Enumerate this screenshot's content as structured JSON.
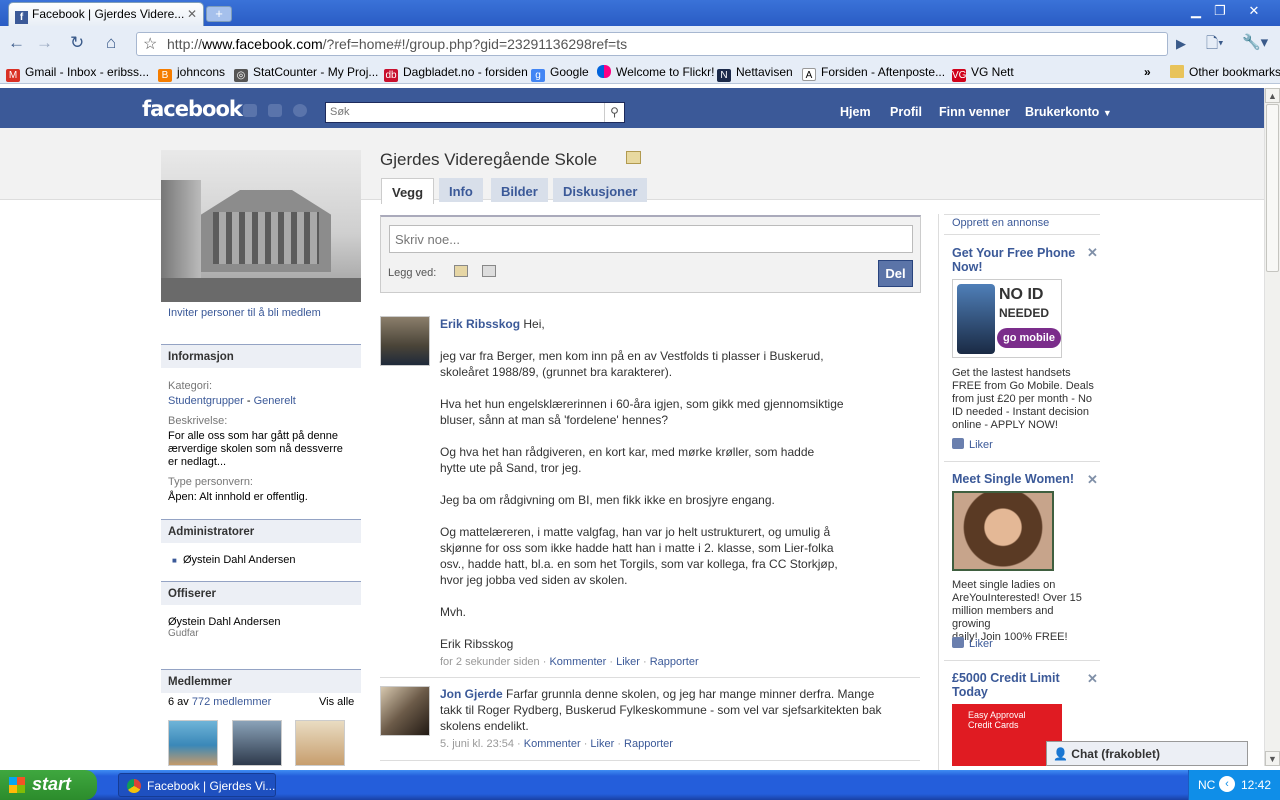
{
  "browser": {
    "tab_title": "Facebook | Gjerdes Videre...",
    "url_prefix": "http://",
    "url_domain": "www.facebook.com",
    "url_rest": "/?ref=home#!/group.php?gid=23291136298ref=ts",
    "bookmarks": [
      "Gmail - Inbox - eribss...",
      "johncons",
      "StatCounter - My Proj...",
      "Dagbladet.no - forsiden",
      "Google",
      "Welcome to Flickr!",
      "Nettavisen",
      "Forsiden - Aftenposte...",
      "VG Nett"
    ],
    "other_bookmarks": "Other bookmarks"
  },
  "fb": {
    "logo": "facebook",
    "search_placeholder": "Søk",
    "nav": [
      "Hjem",
      "Profil",
      "Finn venner",
      "Brukerkonto"
    ]
  },
  "group": {
    "title": "Gjerdes Videregående Skole",
    "tabs": [
      "Vegg",
      "Info",
      "Bilder",
      "Diskusjoner"
    ],
    "invite": "Inviter personer til å bli medlem",
    "info_head": "Informasjon",
    "category_label": "Kategori:",
    "category_a": "Studentgrupper",
    "category_dash": " - ",
    "category_b": "Generelt",
    "desc_label": "Beskrivelse:",
    "desc_1": "For alle oss som har gått på denne",
    "desc_2": "ærverdige skolen som nå dessverre",
    "desc_3": "er nedlagt...",
    "privacy_label": "Type personvern:",
    "privacy": "Åpen: Alt innhold er offentlig.",
    "admins_head": "Administratorer",
    "admin": "Øystein Dahl Andersen",
    "officers_head": "Offiserer",
    "officer": "Øystein Dahl Andersen",
    "officer_role": "Gudfar",
    "members_head": "Medlemmer",
    "members_of": "6 av ",
    "members_count": "772 medlemmer",
    "see_all": "Vis alle"
  },
  "composer": {
    "placeholder": "Skriv noe...",
    "attach": "Legg ved:",
    "share": "Del"
  },
  "posts": [
    {
      "author": "Erik Ribsskog",
      "lines": [
        "Hei,",
        "jeg var fra Berger, men kom inn på en av Vestfolds ti plasser i Buskerud,",
        "skoleåret 1988/89, (grunnet bra karakterer).",
        "Hva het hun engelsklærerinnen i 60-åra igjen, som gikk med gjennomsiktige",
        "bluser, sånn at man så 'fordelene' hennes?",
        "Og hva het han rådgiveren, en kort kar, med mørke krøller, som hadde",
        "hytte ute på Sand, tror jeg.",
        "Jeg ba om rådgivning om BI, men fikk ikke en brosjyre engang.",
        "Og mattelæreren, i matte valgfag, han var jo helt ustrukturert, og umulig å",
        "skjønne for oss som ikke hadde hatt han i matte i 2. klasse, som Lier-folka",
        "osv., hadde hatt, bl.a. en som het Torgils, som var kollega, fra CC Storkjøp,",
        "hvor jeg jobba ved siden av skolen.",
        "Mvh.",
        "Erik Ribsskog"
      ],
      "time": "for 2 sekunder siden",
      "actions": [
        "Kommenter",
        "Liker",
        "Rapporter"
      ]
    },
    {
      "author": "Jon Gjerde",
      "lines": [
        "Farfar grunnla denne skolen, og jeg har mange minner derfra. Mange",
        "takk til Roger Rydberg, Buskerud Fylkeskommune - som vel var sjefsarkitekten bak",
        "skolens endelikt."
      ],
      "time": "5. juni kl. 23:54",
      "actions": [
        "Kommenter",
        "Liker",
        "Rapporter"
      ]
    }
  ],
  "ads": {
    "create": "Opprett en annonse",
    "items": [
      {
        "title_1": "Get Your Free Phone",
        "title_2": "Now!",
        "img_1": "NO ID",
        "img_2": "NEEDED",
        "img_3": "go mobile",
        "text": [
          "Get the lastest handsets",
          "FREE from Go Mobile. Deals",
          "from just £20 per month - No",
          "ID needed - Instant decision",
          "online - APPLY NOW!"
        ],
        "like": "Liker"
      },
      {
        "title_1": "Meet Single Women!",
        "text": [
          "Meet single ladies on",
          "AreYouInterested! Over 15",
          "million members and growing",
          "daily! Join 100% FREE!"
        ],
        "like": "Liker"
      },
      {
        "title_1": "£5000 Credit Limit",
        "title_2": "Today",
        "img_1": "Easy Approval",
        "img_2": "Credit Cards"
      }
    ]
  },
  "chat": "Chat (frakoblet)",
  "taskbar": {
    "start": "start",
    "task": "Facebook | Gjerdes Vi...",
    "lang": "NC",
    "clock": "12:42"
  }
}
